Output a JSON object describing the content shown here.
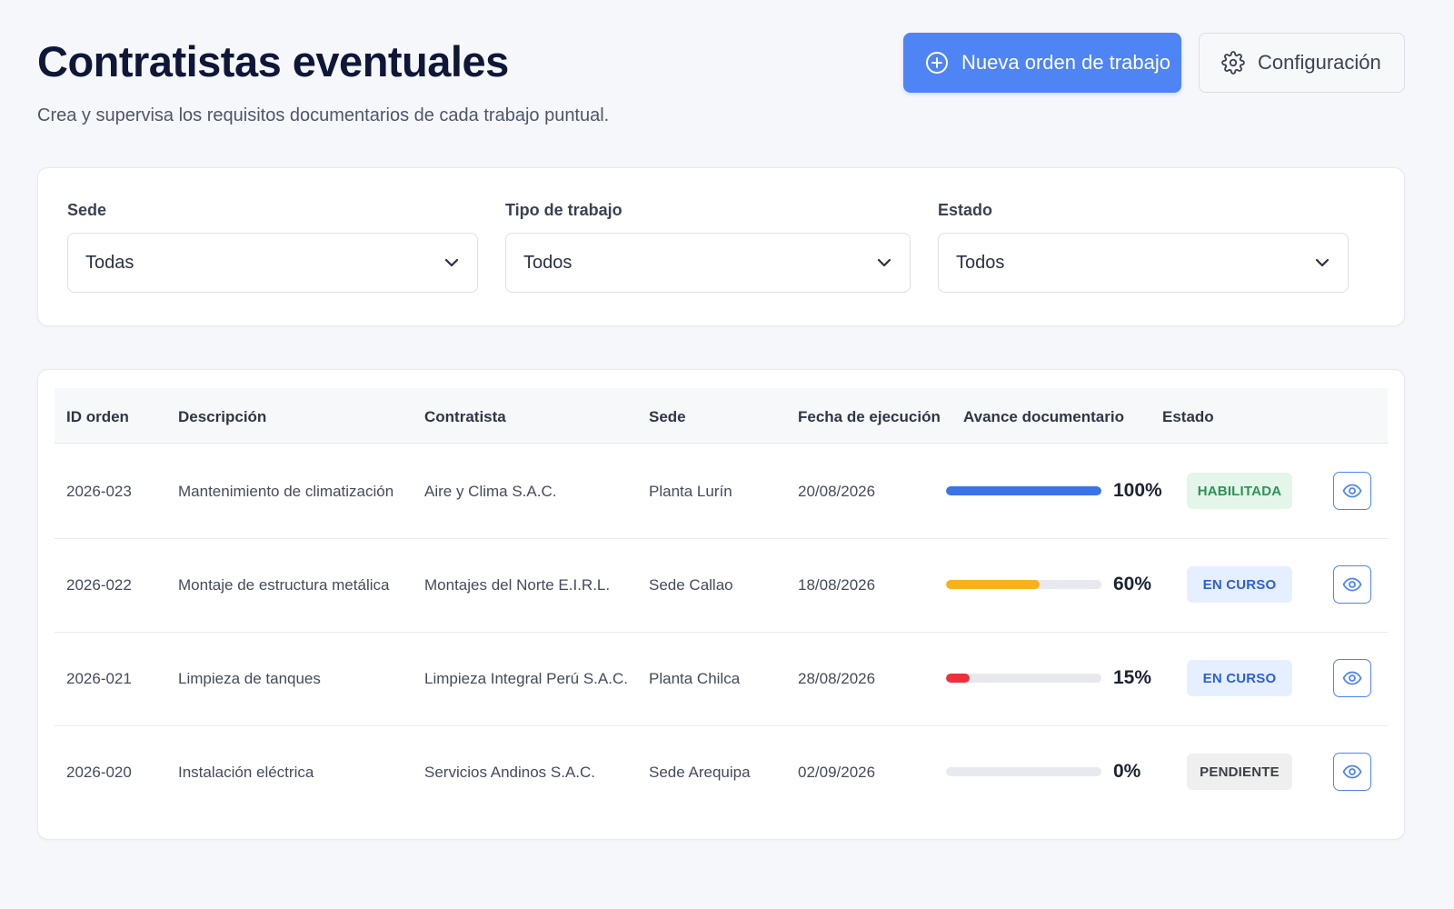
{
  "header": {
    "title": "Contratistas eventuales",
    "subtitle": "Crea y supervisa los requisitos documentarios de cada trabajo puntual.",
    "primary_button": {
      "label": "Nueva orden de trabajo",
      "icon": "plus-circle-icon"
    },
    "secondary_button": {
      "label": "Configuración",
      "icon": "gear-icon"
    }
  },
  "filters": [
    {
      "label": "Sede",
      "value": "Todas"
    },
    {
      "label": "Tipo de trabajo",
      "value": "Todos"
    },
    {
      "label": "Estado",
      "value": "Todos"
    }
  ],
  "table": {
    "columns": [
      "ID orden",
      "Descripción",
      "Contratista",
      "Sede",
      "Fecha de ejecución",
      "Avance documentario",
      "Estado"
    ],
    "rows": [
      {
        "id": "2026-023",
        "descripcion": "Mantenimiento de climatización",
        "contratista": "Aire y Clima S.A.C.",
        "sede": "Planta Lurín",
        "fecha": "20/08/2026",
        "avance": 100,
        "avance_label": "100%",
        "bar_color": "#3a73ea",
        "estado": "HABILITADA",
        "estado_bg": "#e4f5ea",
        "estado_color": "#2f9155"
      },
      {
        "id": "2026-022",
        "descripcion": "Montaje de estructura metálica",
        "contratista": "Montajes del Norte E.I.R.L.",
        "sede": "Sede Callao",
        "fecha": "18/08/2026",
        "avance": 60,
        "avance_label": "60%",
        "bar_color": "#f7b21b",
        "estado": "EN CURSO",
        "estado_bg": "#e6efff",
        "estado_color": "#2c5fd8"
      },
      {
        "id": "2026-021",
        "descripcion": "Limpieza de tanques",
        "contratista": "Limpieza Integral Perú S.A.C.",
        "sede": "Planta Chilca",
        "fecha": "28/08/2026",
        "avance": 15,
        "avance_label": "15%",
        "bar_color": "#ef2f3c",
        "estado": "EN CURSO",
        "estado_bg": "#e6efff",
        "estado_color": "#2c5fd8"
      },
      {
        "id": "2026-020",
        "descripcion": "Instalación eléctrica",
        "contratista": "Servicios Andinos S.A.C.",
        "sede": "Sede Arequipa",
        "fecha": "02/09/2026",
        "avance": 0,
        "avance_label": "0%",
        "bar_color": "#3a73ea",
        "estado": "PENDIENTE",
        "estado_bg": "#efefef",
        "estado_color": "#3d3f45"
      }
    ],
    "row_action_icon": "eye-icon"
  },
  "colors": {
    "accent": "#4f84f4",
    "background": "#f6f7fa",
    "title": "#0f1738"
  }
}
